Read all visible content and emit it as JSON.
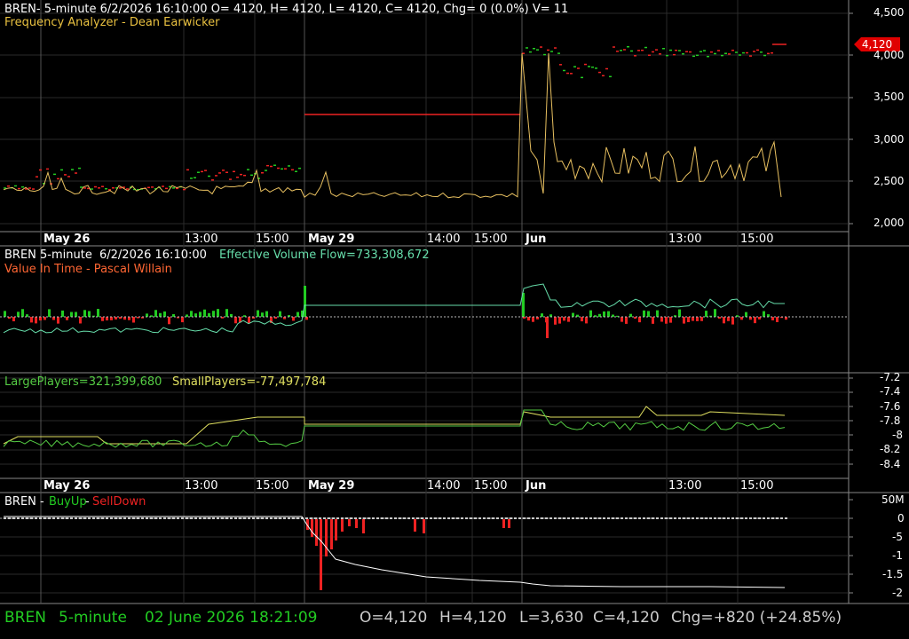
{
  "panel1": {
    "header": "BREN- 5-minute 6/2/2026 16:10:00 O= 4120, H= 4120, L= 4120, C= 4120, Chg= 0 (0.0%) V= 11",
    "indicator": "Frequency Analyzer - Dean Earwicker",
    "price_tag": "4,120",
    "yaxis": [
      "4,500",
      "4,000",
      "3,500",
      "3,000",
      "2,500",
      "2,000"
    ]
  },
  "date_axis": [
    "May 26",
    "13:00",
    "15:00",
    "May 29",
    "14:00",
    "15:00",
    "Jun",
    "13:00",
    "15:00"
  ],
  "panel2": {
    "symbol": "BREN 5-minute",
    "timestamp": "6/2/2026 16:10:00",
    "flow": "Effective Volume Flow=733,308,672",
    "indicator": "Value In Time - Pascal Willain"
  },
  "panel3": {
    "large": "LargePlayers=321,399,680",
    "small": "SmallPlayers=-77,497,784",
    "yaxis": [
      "-7.2",
      "-7.4",
      "-7.6",
      "-7.8",
      "-8",
      "-8.2",
      "-8.4"
    ]
  },
  "panel4": {
    "symbol": "BREN -",
    "buyup": "BuyUp",
    "dash": "-",
    "selldown": "SellDown",
    "yaxis": [
      "50M",
      "0",
      "-5",
      "-1",
      "-1.5",
      "-2"
    ]
  },
  "status": {
    "symbol": "BREN",
    "interval": "5-minute",
    "datetime": "02 June 2026 18:21:09",
    "open": "O=4,120",
    "high": "H=4,120",
    "low": "L=3,630",
    "close": "C=4,120",
    "change": "Chg=+820 (+24.85%)"
  },
  "colors": {
    "up": "#22cc22",
    "down": "#ee2222",
    "freq": "#e8c060",
    "flow": "#66ddaa",
    "large": "#55cc44",
    "small": "#e0e060",
    "cumline": "#ffffff"
  }
}
